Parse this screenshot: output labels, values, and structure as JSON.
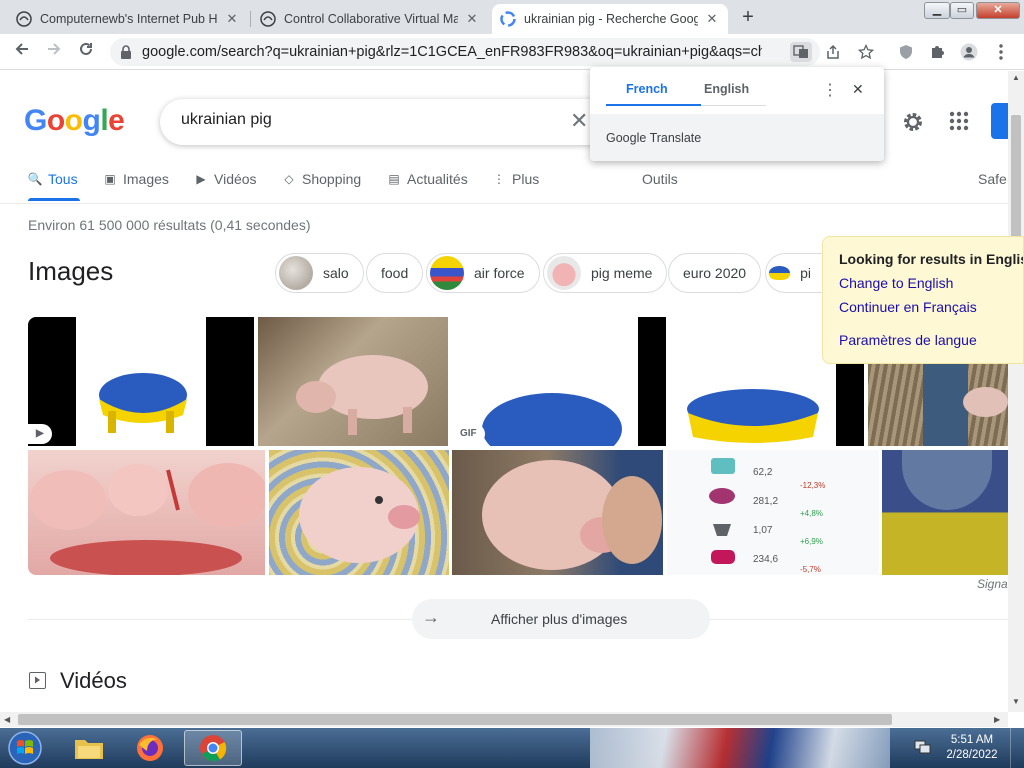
{
  "browser": {
    "tabs": [
      {
        "title": "Computernewb's Internet Pub Hu",
        "favicon": "vm-icon"
      },
      {
        "title": "Control Collaborative Virtual Ma",
        "favicon": "vm-icon"
      },
      {
        "title": "ukrainian pig - Recherche Google",
        "favicon": "google-icon"
      }
    ],
    "close_glyph": "✕",
    "new_tab": "+",
    "window_controls": {
      "minimize": "▁",
      "maximize": "▭",
      "close": "✕"
    },
    "url": "google.com/search?q=ukrainian+pig&rlz=1C1GCEA_enFR983FR983&oq=ukrainian+pig&aqs=chrom..."
  },
  "google": {
    "logo": [
      "G",
      "o",
      "o",
      "g",
      "l",
      "e"
    ],
    "logo_colors": [
      "#4285f4",
      "#ea4335",
      "#fbbc05",
      "#4285f4",
      "#34a853",
      "#ea4335"
    ],
    "query": "ukrainian pig",
    "clear": "✕",
    "tabs": [
      {
        "label": "Tous",
        "icon": "🔍"
      },
      {
        "label": "Images",
        "icon": "▣"
      },
      {
        "label": "Vidéos",
        "icon": "▶"
      },
      {
        "label": "Shopping",
        "icon": "◇"
      },
      {
        "label": "Actualités",
        "icon": "▤"
      },
      {
        "label": "Plus",
        "icon": "⋮"
      }
    ],
    "tools": "Outils",
    "safe": "Safe",
    "result_stats": "Environ 61 500 000 résultats (0,41 secondes)",
    "images_heading": "Images",
    "chips": [
      "salo",
      "food",
      "air force",
      "pig meme",
      "euro 2020",
      "pi"
    ],
    "thumbnail_badges": {
      "video": "▶",
      "gif": "GIF"
    },
    "infographic": {
      "values": [
        "62,2",
        "281,2",
        "1,07",
        "234,6"
      ],
      "changes": [
        "-12,3%",
        "+4,8%",
        "+6,9%",
        "-5,7%"
      ]
    },
    "source_caption": "Signa",
    "more_images": "Afficher plus d'images",
    "more_arrow": "→",
    "videos_heading": "Vidéos"
  },
  "translate_popup": {
    "lang_from": "French",
    "lang_to": "English",
    "menu": "⋮",
    "close": "✕",
    "brand_google": "Google",
    "brand_translate": "Translate"
  },
  "language_panel": {
    "title": "Looking for results in English?",
    "change_link": "Change to English",
    "continue_link": "Continuer en Français",
    "settings_link": "Paramètres de langue"
  },
  "taskbar": {
    "time": "5:51 AM",
    "date": "2/28/2022",
    "apps": [
      "file-explorer",
      "firefox",
      "chrome"
    ]
  },
  "colors": {
    "accent": "#1a73e8",
    "link": "#1a0dab",
    "language_panel_bg": "#fef9d4",
    "ukraine_blue": "#2a5cbf",
    "ukraine_yellow": "#f5d300"
  }
}
